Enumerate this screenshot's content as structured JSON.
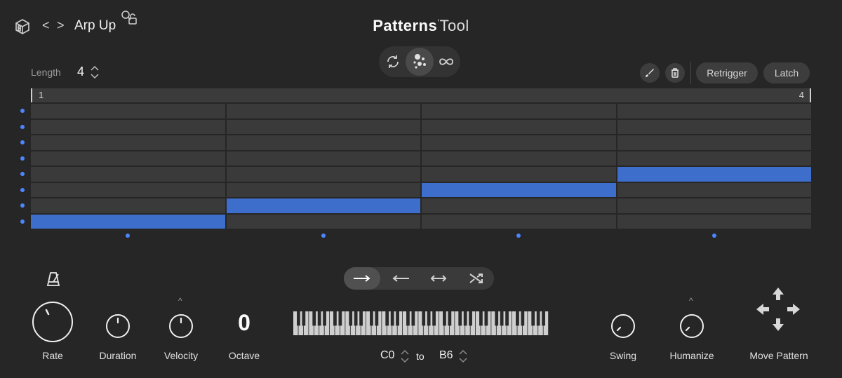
{
  "header": {
    "pattern_name": "Arp Up",
    "brand_primary": "Patterns",
    "brand_secondary": "Tool",
    "prev_glyph": "<",
    "next_glyph": ">"
  },
  "length": {
    "label": "Length",
    "value": "4"
  },
  "toolbar": {
    "retrigger_label": "Retrigger",
    "latch_label": "Latch"
  },
  "ruler": {
    "start": "1",
    "end": "4"
  },
  "grid": {
    "columns": 4,
    "rows": 8,
    "active_cells": [
      {
        "step": 1,
        "row_from_bottom": 1
      },
      {
        "step": 2,
        "row_from_bottom": 2
      },
      {
        "step": 3,
        "row_from_bottom": 3
      },
      {
        "step": 4,
        "row_from_bottom": 4
      }
    ],
    "accent_color": "#3e6ecb",
    "dot_color": "#4c86ff"
  },
  "controls": {
    "rate_label": "Rate",
    "duration_label": "Duration",
    "velocity_label": "Velocity",
    "octave_label": "Octave",
    "octave_value": "0",
    "swing_label": "Swing",
    "humanize_label": "Humanize",
    "move_pattern_label": "Move Pattern",
    "caret_glyph": "^"
  },
  "range": {
    "from": "C0",
    "to_label": "to",
    "to": "B6"
  },
  "direction": {
    "options": [
      "forward",
      "backward",
      "ping-pong",
      "random"
    ],
    "selected": "forward"
  }
}
